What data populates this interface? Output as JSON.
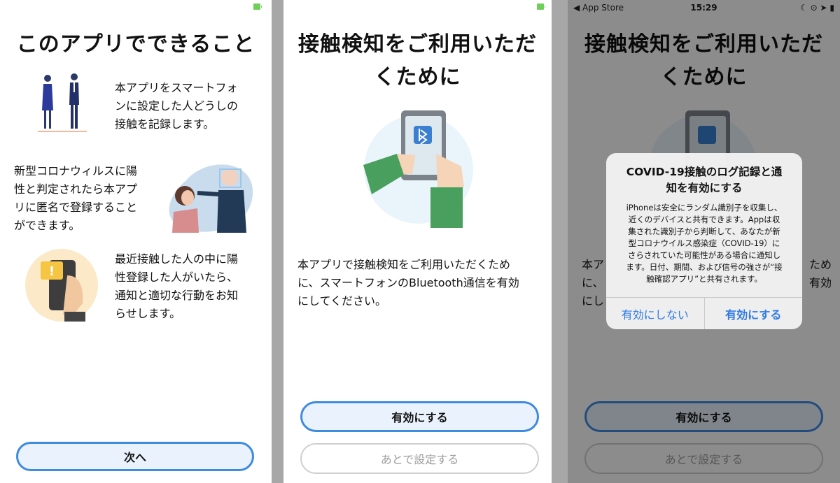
{
  "screen1": {
    "title": "このアプリでできること",
    "feature1": [
      "本アプリをスマートフォ",
      "ンに設定した人どうしの",
      "接触を記録します。"
    ],
    "feature2": [
      "新型コロナウィルスに陽",
      "性と判定されたら本アプ",
      "リに匿名で登録すること",
      "ができます。"
    ],
    "feature3": [
      "最近接触した人の中に陽",
      "性登録した人がいたら、",
      "通知と適切な行動をお知",
      "らせします。"
    ],
    "next_button": "次へ",
    "colors": {
      "accent": "#3e8be0",
      "button_bg": "#eaf3fd"
    }
  },
  "screen2": {
    "title": [
      "接触検知をご利用いただ",
      "くために"
    ],
    "body": [
      "本アプリで接触検知をご利用いただくため",
      "に、スマートフォンのBluetooth通信を有効",
      "にしてください。"
    ],
    "enable_button": "有効にする",
    "later_button": "あとで設定する"
  },
  "screen3": {
    "status": {
      "carrier": "◀ App Store",
      "time": "15:29"
    },
    "title": [
      "接触検知をご利用いただ",
      "くために"
    ],
    "body": [
      "本ア",
      "に、",
      "にし"
    ],
    "body_right": [
      "ため",
      "有効"
    ],
    "enable_button": "有効にする",
    "later_button": "あとで設定する",
    "alert": {
      "title": [
        "COVID-19接触のログ記録と通",
        "知を有効にする"
      ],
      "message": [
        "iPhoneは安全にランダム識別子を収集し、",
        "近くのデバイスと共有できます。Appは収",
        "集された識別子から判断して、あなたが新",
        "型コロナウイルス感染症（COVID-19）に",
        "さらされていた可能性がある場合に通知し",
        "ます。日付、期間、および信号の強さが“接",
        "触確認アプリ”と共有されます。"
      ],
      "deny_button": "有効にしない",
      "allow_button": "有効にする"
    }
  }
}
